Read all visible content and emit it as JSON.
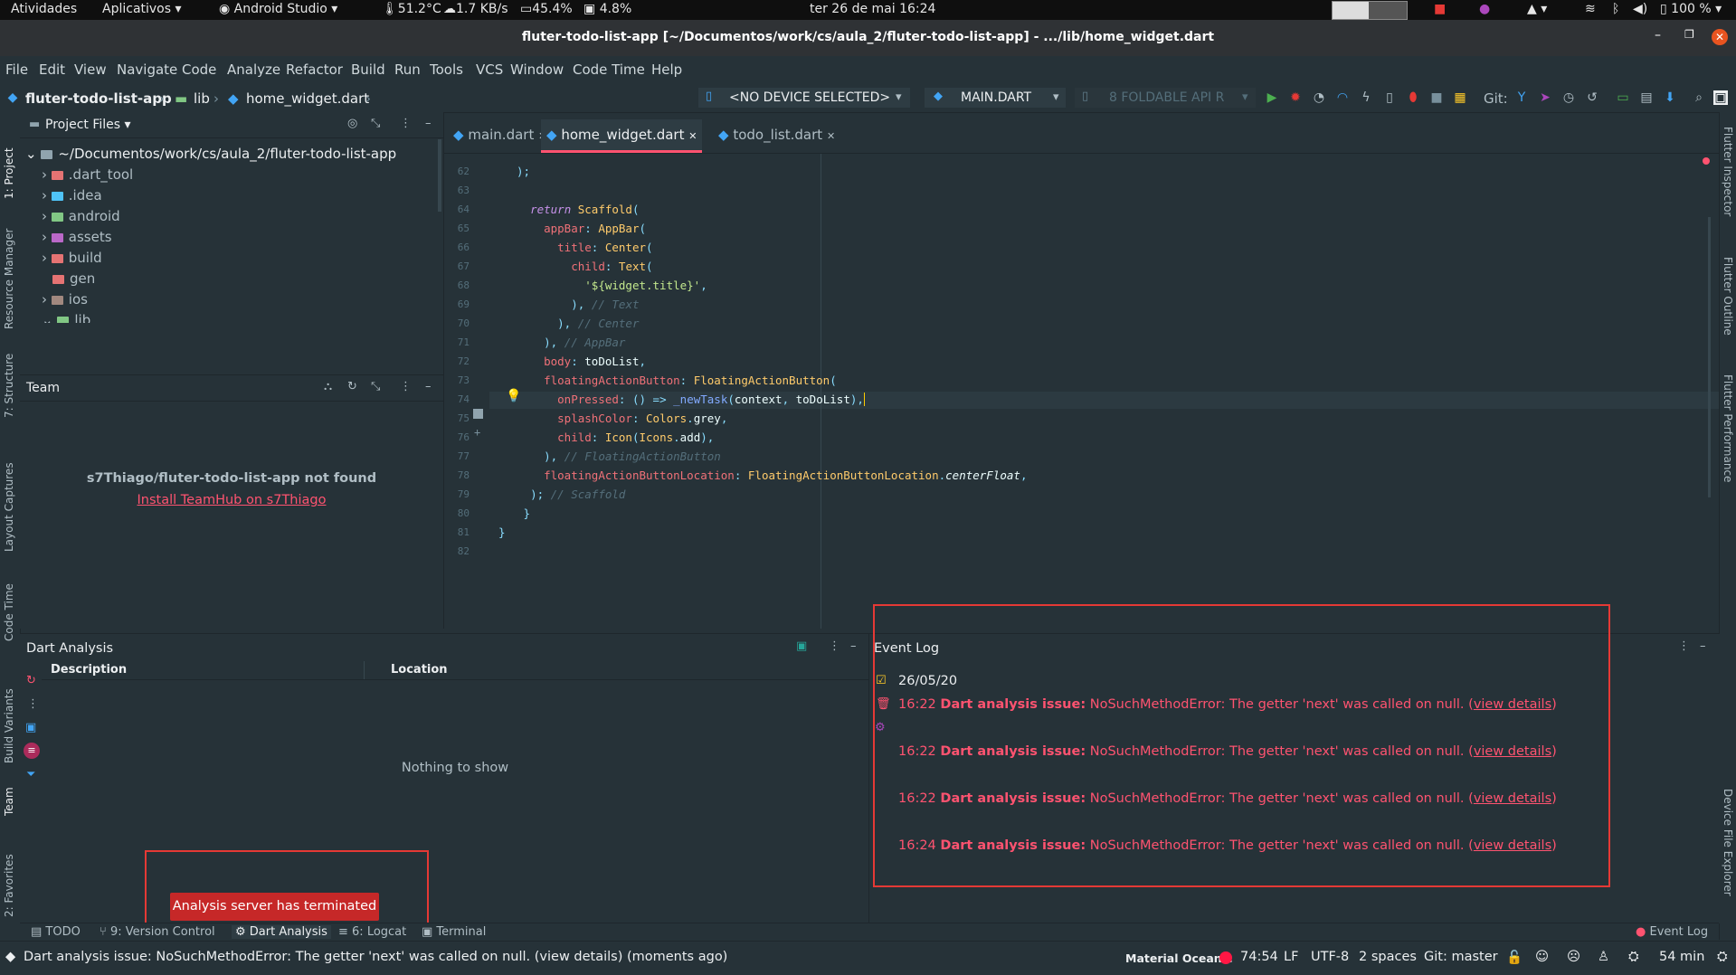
{
  "gnome": {
    "activities": "Atividades",
    "apps": "Aplicativos ▾",
    "focused_app": "Android Studio ▾",
    "temp": "51.2°C",
    "net": "1.7 KB/s",
    "mem": "45.4%",
    "cpu": "4.8%",
    "datetime": "ter 26 de mai  16:24",
    "battery": "100 % ▾"
  },
  "window": {
    "title": "fluter-todo-list-app [~/Documentos/work/cs/aula_2/fluter-todo-list-app] - .../lib/home_widget.dart"
  },
  "menu": [
    "File",
    "Edit",
    "View",
    "Navigate",
    "Code",
    "Analyze",
    "Refactor",
    "Build",
    "Run",
    "Tools",
    "VCS",
    "Window",
    "Code Time",
    "Help"
  ],
  "breadcrumb": {
    "project": "fluter-todo-list-app",
    "folder": "lib",
    "file": "home_widget.dart"
  },
  "toolbar": {
    "device": "<NO DEVICE SELECTED>",
    "run_config": "MAIN.DART",
    "emulator": "8 FOLDABLE API R",
    "git_label": "Git:"
  },
  "left_tabs": [
    "1: Project",
    "Resource Manager",
    "7: Structure",
    "Layout Captures",
    "Code Time",
    "Build Variants",
    "Team",
    "2: Favorites"
  ],
  "right_tabs": [
    "Flutter Inspector",
    "Flutter Outline",
    "Flutter Performance",
    "Device File Explorer"
  ],
  "project": {
    "header": "Project Files ▾",
    "root": "~/Documentos/work/cs/aula_2/fluter-todo-list-app",
    "items": [
      {
        "name": ".dart_tool",
        "color": "#e57373",
        "arrow": "›"
      },
      {
        "name": ".idea",
        "color": "#4fc3f7",
        "arrow": "›"
      },
      {
        "name": "android",
        "color": "#81c784",
        "arrow": "›"
      },
      {
        "name": "assets",
        "color": "#ba68c8",
        "arrow": "›"
      },
      {
        "name": "build",
        "color": "#e57373",
        "arrow": "›"
      },
      {
        "name": "gen",
        "color": "#e57373",
        "arrow": ""
      },
      {
        "name": "ios",
        "color": "#a1887f",
        "arrow": "›"
      },
      {
        "name": "lib",
        "color": "#81c784",
        "arrow": "⌄"
      }
    ]
  },
  "team": {
    "header": "Team",
    "not_found": "s7Thiago/fluter-todo-list-app not found",
    "install_link": "Install TeamHub on s7Thiago"
  },
  "editor": {
    "tabs": [
      {
        "label": "main.dart",
        "active": false
      },
      {
        "label": "home_widget.dart",
        "active": true
      },
      {
        "label": "todo_list.dart",
        "active": false
      }
    ],
    "line_numbers": [
      "62",
      "63",
      "64",
      "65",
      "66",
      "67",
      "68",
      "69",
      "70",
      "71",
      "72",
      "73",
      "74",
      "75",
      "76",
      "77",
      "78",
      "79",
      "80",
      "81",
      "82"
    ]
  },
  "dart_analysis": {
    "header": "Dart Analysis",
    "col_description": "Description",
    "col_location": "Location",
    "empty": "Nothing to show",
    "toast": "Analysis server has terminated"
  },
  "event_log": {
    "header": "Event Log",
    "date": "26/05/20",
    "entries": [
      {
        "time": "16:22",
        "title": "Dart analysis issue:",
        "msg": "NoSuchMethodError: The getter 'next' was called on null. (",
        "link": "view details",
        "end": ")"
      },
      {
        "time": "16:22",
        "title": "Dart analysis issue:",
        "msg": "NoSuchMethodError: The getter 'next' was called on null. (",
        "link": "view details",
        "end": ")"
      },
      {
        "time": "16:22",
        "title": "Dart analysis issue:",
        "msg": "NoSuchMethodError: The getter 'next' was called on null. (",
        "link": "view details",
        "end": ")"
      },
      {
        "time": "16:24",
        "title": "Dart analysis issue:",
        "msg": "NoSuchMethodError: The getter 'next' was called on null. (",
        "link": "view details",
        "end": ")"
      }
    ]
  },
  "bottom_tools": [
    "TODO",
    "9: Version Control",
    "Dart Analysis",
    "6: Logcat",
    "Terminal",
    "Event Log"
  ],
  "status": {
    "message": "Dart analysis issue: NoSuchMethodError: The getter 'next' was called on null. (view details) (moments ago)",
    "theme": "Material Oceanic",
    "position": "74:54",
    "line_sep": "LF",
    "encoding": "UTF-8",
    "indent": "2 spaces",
    "git": "Git: master",
    "time": "54 min"
  }
}
